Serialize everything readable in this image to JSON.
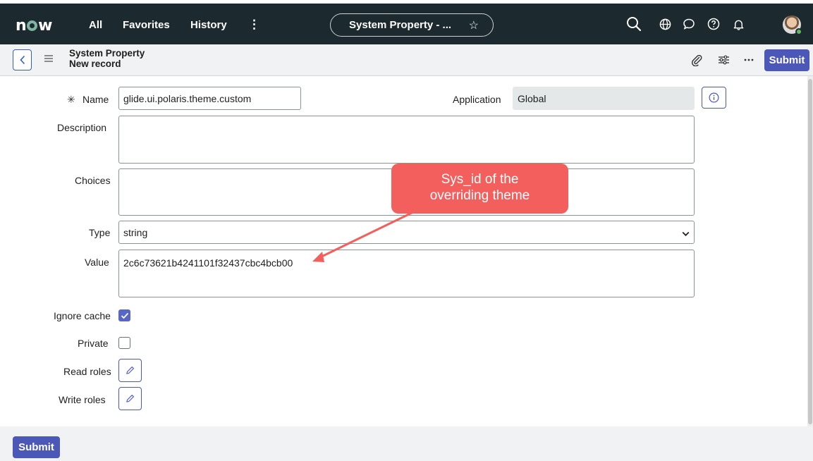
{
  "header": {
    "logo_text": "now",
    "nav": {
      "all": "All",
      "favorites": "Favorites",
      "history": "History"
    },
    "context_pill": "System Property - ...",
    "icons": [
      "search-icon",
      "globe-icon",
      "chat-icon",
      "help-icon",
      "bell-icon",
      "avatar"
    ]
  },
  "record": {
    "title": "System Property",
    "subtitle": "New record",
    "submit_label": "Submit",
    "toolbar_icons": [
      "paperclip-icon",
      "settings-sliders-icon",
      "more-icon"
    ]
  },
  "form": {
    "required_mark": "✳",
    "name_label": "Name",
    "name_value": "glide.ui.polaris.theme.custom",
    "application_label": "Application",
    "application_value": "Global",
    "description_label": "Description",
    "description_value": "",
    "choices_label": "Choices",
    "choices_value": "",
    "type_label": "Type",
    "type_value": "string",
    "value_label": "Value",
    "value_value": "2c6c73621b4241101f32437cbc4bcb00",
    "ignore_cache_label": "Ignore cache",
    "ignore_cache_checked": true,
    "private_label": "Private",
    "private_checked": false,
    "read_roles_label": "Read roles",
    "write_roles_label": "Write roles"
  },
  "annotation": {
    "line1": "Sys_id of the",
    "line2": "overriding theme",
    "color": "#f25f5c"
  },
  "footer": {
    "submit_label": "Submit"
  },
  "colors": {
    "header_bg": "#1c2a30",
    "accent": "#4b58b8",
    "logo_o": "#81b5a1"
  }
}
